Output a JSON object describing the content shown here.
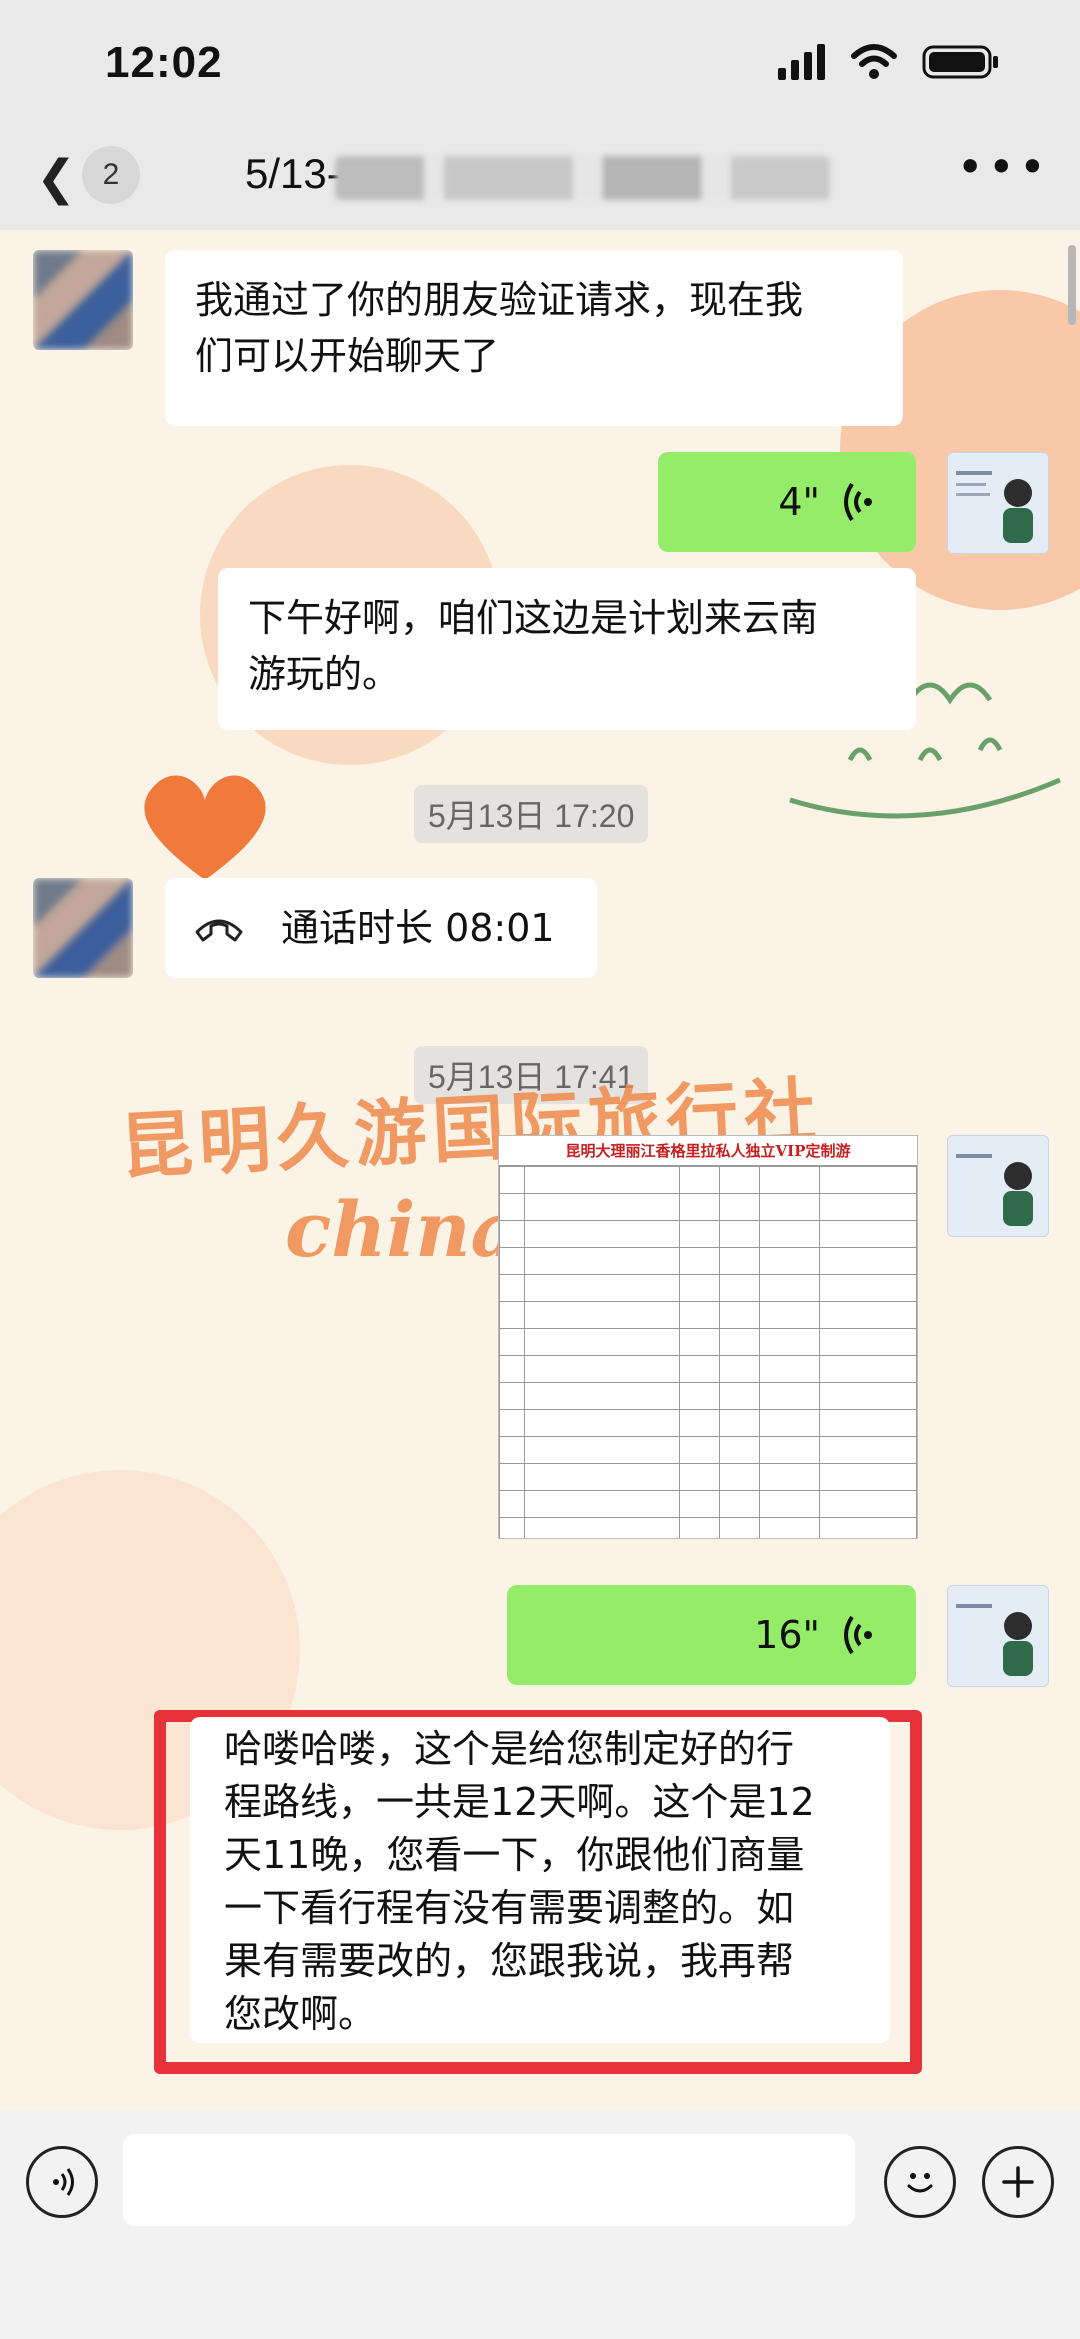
{
  "status_bar": {
    "time": "12:02"
  },
  "nav": {
    "badge": "2",
    "title_prefix": "5/13-"
  },
  "messages": {
    "m1": {
      "line1": "我通过了你的朋友验证请求，现在我",
      "line2": "们可以开始聊天了"
    },
    "m2": {
      "duration": "4\""
    },
    "m3": {
      "line1": "下午好啊，咱们这边是计划来云南",
      "line2": "游玩的。"
    },
    "ts1": "5月13日 17:20",
    "call": {
      "label": "通话时长 08:01"
    },
    "ts2": "5月13日 17:41",
    "doc": {
      "title": "昆明大理丽江香格里拉私人独立VIP定制游"
    },
    "m5": {
      "duration": "16\""
    },
    "m6": {
      "l1": "哈喽哈喽，这个是给您制定好的行",
      "l2": "程路线，一共是12天啊。这个是12",
      "l3": "天11晚，您看一下，你跟他们商量",
      "l4": "一下看行程有没有需要调整的。如",
      "l5": "果有需要改的，您跟我说，我再帮",
      "l6": "您改啊。"
    }
  },
  "watermark": {
    "line1": "昆明久游国际旅行社",
    "line2": "china"
  },
  "colors": {
    "green_bubble": "#95ec69",
    "highlight_box": "#e8323a",
    "watermark": "#f08a4b"
  }
}
